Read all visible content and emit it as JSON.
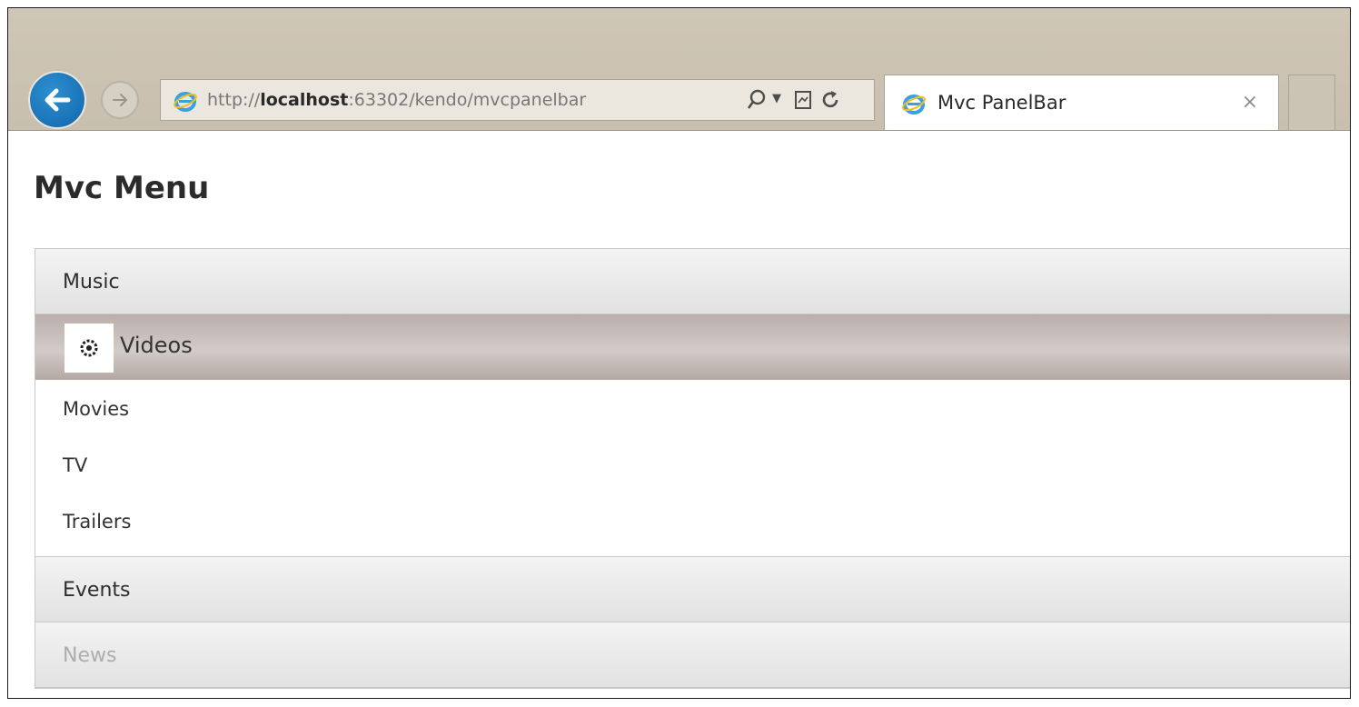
{
  "browser": {
    "url_prefix": "http://",
    "url_host": "localhost",
    "url_rest": ":63302/kendo/mvcpanelbar",
    "search_icon": "search-icon",
    "compat_icon": "compatibility-view-icon",
    "refresh_icon": "refresh-icon",
    "tab_title": "Mvc PanelBar",
    "tab_close": "×",
    "accent_color": "#1a72b7"
  },
  "page": {
    "title": "Mvc Menu"
  },
  "panelbar": {
    "items": [
      {
        "label": "Music"
      },
      {
        "label": "Videos",
        "icon": "gear-icon",
        "expanded": true,
        "children": [
          {
            "label": "Movies"
          },
          {
            "label": "TV"
          },
          {
            "label": "Trailers"
          }
        ]
      },
      {
        "label": "Events"
      },
      {
        "label": "News",
        "disabled": true
      }
    ]
  }
}
